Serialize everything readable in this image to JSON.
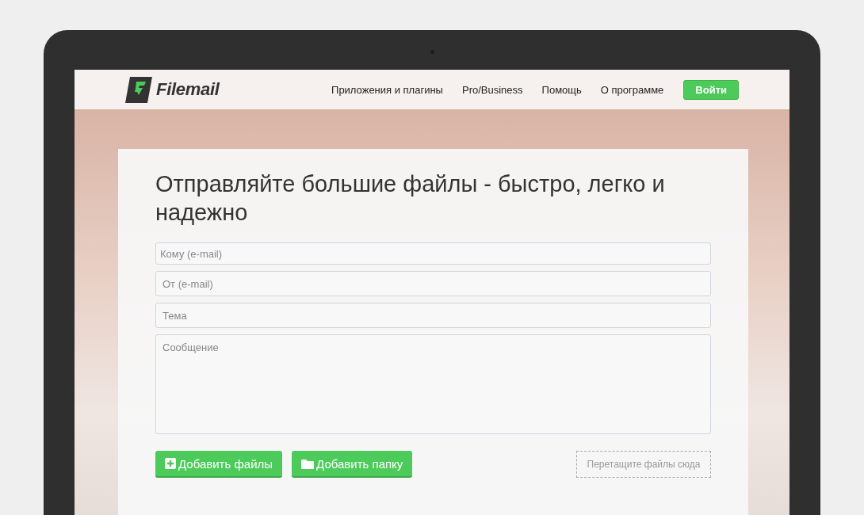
{
  "logo": {
    "text": "Filemail"
  },
  "nav": {
    "items": [
      "Приложения и плагины",
      "Pro/Business",
      "Помощь",
      "О программе"
    ],
    "login_button": "Войти"
  },
  "form": {
    "title": "Отправляйте большие файлы - быстро, легко и надежно",
    "fields": [
      {
        "kind": "input",
        "placeholder": "Кому (e-mail)"
      },
      {
        "kind": "input",
        "placeholder": "От (e-mail)"
      },
      {
        "kind": "input",
        "placeholder": "Тема"
      },
      {
        "kind": "textarea",
        "placeholder": "Сообщение"
      }
    ],
    "buttons": [
      {
        "kind": "add-files",
        "label": "Добавить файлы"
      },
      {
        "kind": "add-folder",
        "label": "Добавить папку"
      }
    ],
    "drop_zone": "Перетащите файлы сюда"
  }
}
